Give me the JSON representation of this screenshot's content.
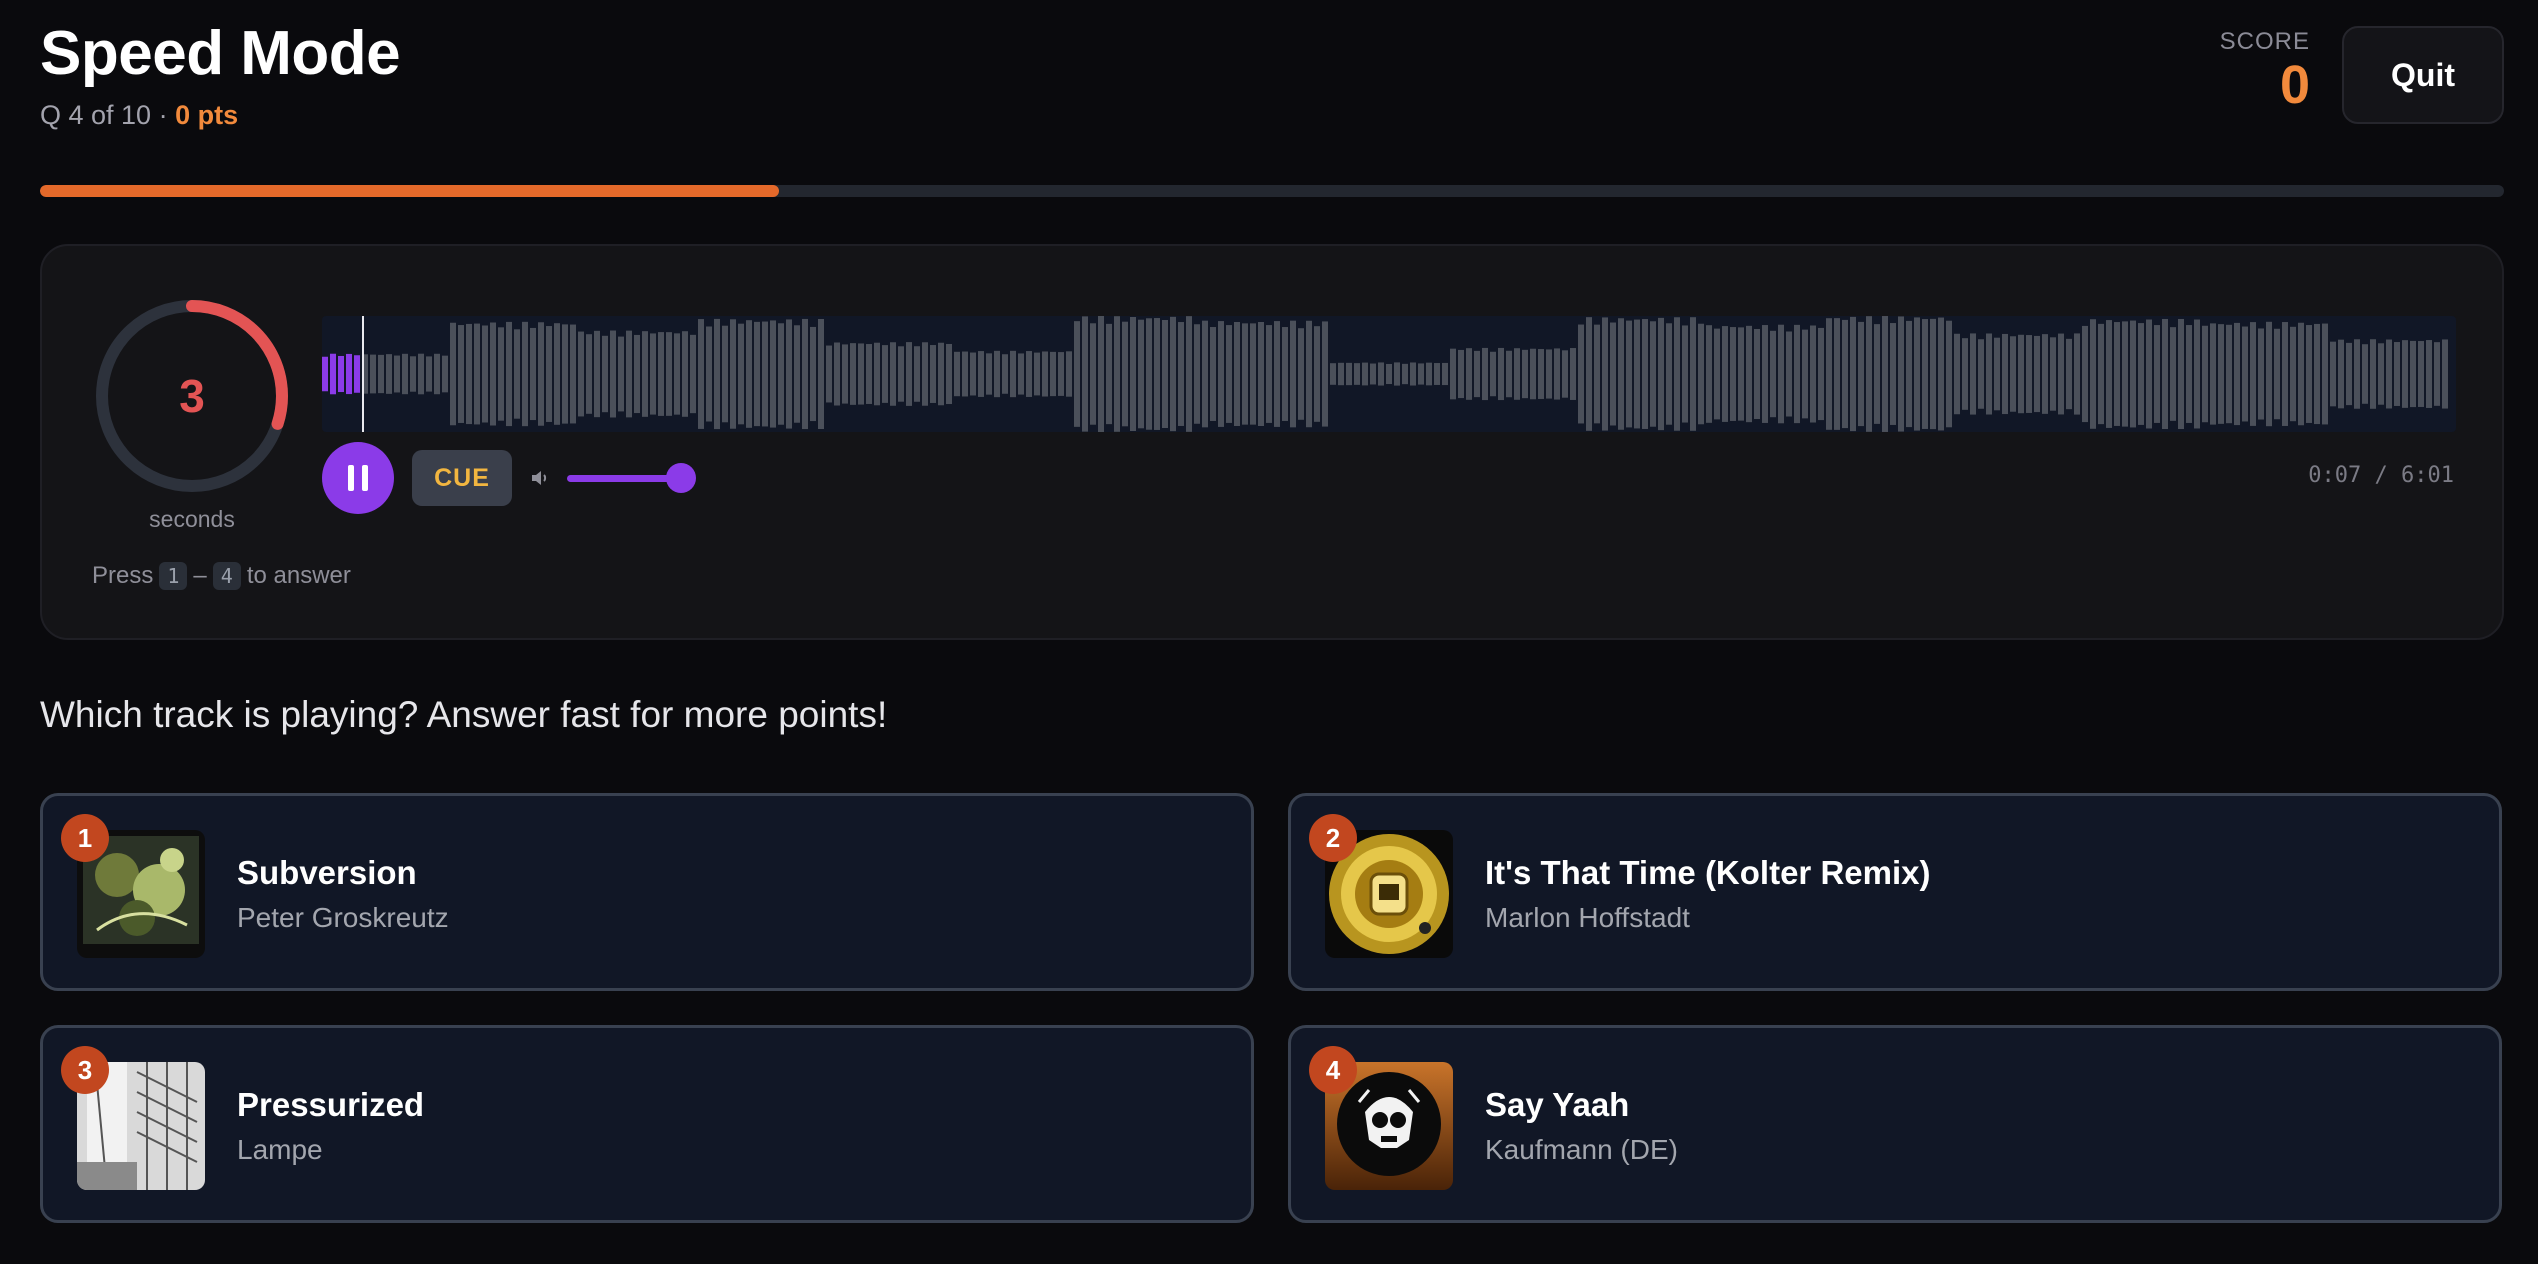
{
  "header": {
    "title": "Speed Mode",
    "question_progress": "Q 4 of 10",
    "separator": "·",
    "points": "0 pts",
    "score_label": "SCORE",
    "score_value": "0",
    "quit_label": "Quit"
  },
  "progress": {
    "fraction": 0.3,
    "accent_color": "#e4692a"
  },
  "player": {
    "countdown_value": "3",
    "countdown_unit": "seconds",
    "countdown_fraction": 0.3,
    "hint_prefix": "Press",
    "hint_key_start": "1",
    "hint_dash": "–",
    "hint_key_end": "4",
    "hint_suffix": "to answer",
    "play_state": "playing",
    "cue_label": "CUE",
    "volume_fraction": 0.85,
    "time_readout": "0:07 / 6:01",
    "playback_fraction": 0.019,
    "accent_color": "#8b3be8"
  },
  "question": "Which track is playing? Answer fast for more points!",
  "answers": [
    {
      "number": "1",
      "title": "Subversion",
      "artist": "Peter Groskreutz",
      "art_icon": "album-art-green-abstract"
    },
    {
      "number": "2",
      "title": "It's That Time (Kolter Remix)",
      "artist": "Marlon Hoffstadt",
      "art_icon": "album-art-gold-vinyl"
    },
    {
      "number": "3",
      "title": "Pressurized",
      "artist": "Lampe",
      "art_icon": "album-art-bw-grid"
    },
    {
      "number": "4",
      "title": "Say Yaah",
      "artist": "Kaufmann (DE)",
      "art_icon": "album-art-skull"
    }
  ]
}
